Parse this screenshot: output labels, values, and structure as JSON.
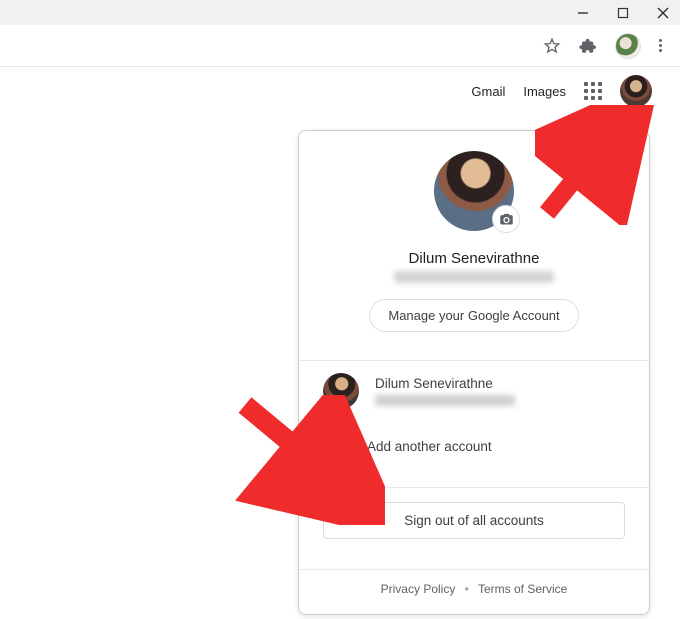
{
  "header_links": {
    "gmail": "Gmail",
    "images": "Images"
  },
  "account_panel": {
    "primary_name": "Dilum Senevirathne",
    "manage_button": "Manage your Google Account",
    "secondary_account_name": "Dilum Senevirathne",
    "add_account_label": "Add another account",
    "sign_out_label": "Sign out of all accounts",
    "footer": {
      "privacy": "Privacy Policy",
      "terms": "Terms of Service"
    }
  }
}
